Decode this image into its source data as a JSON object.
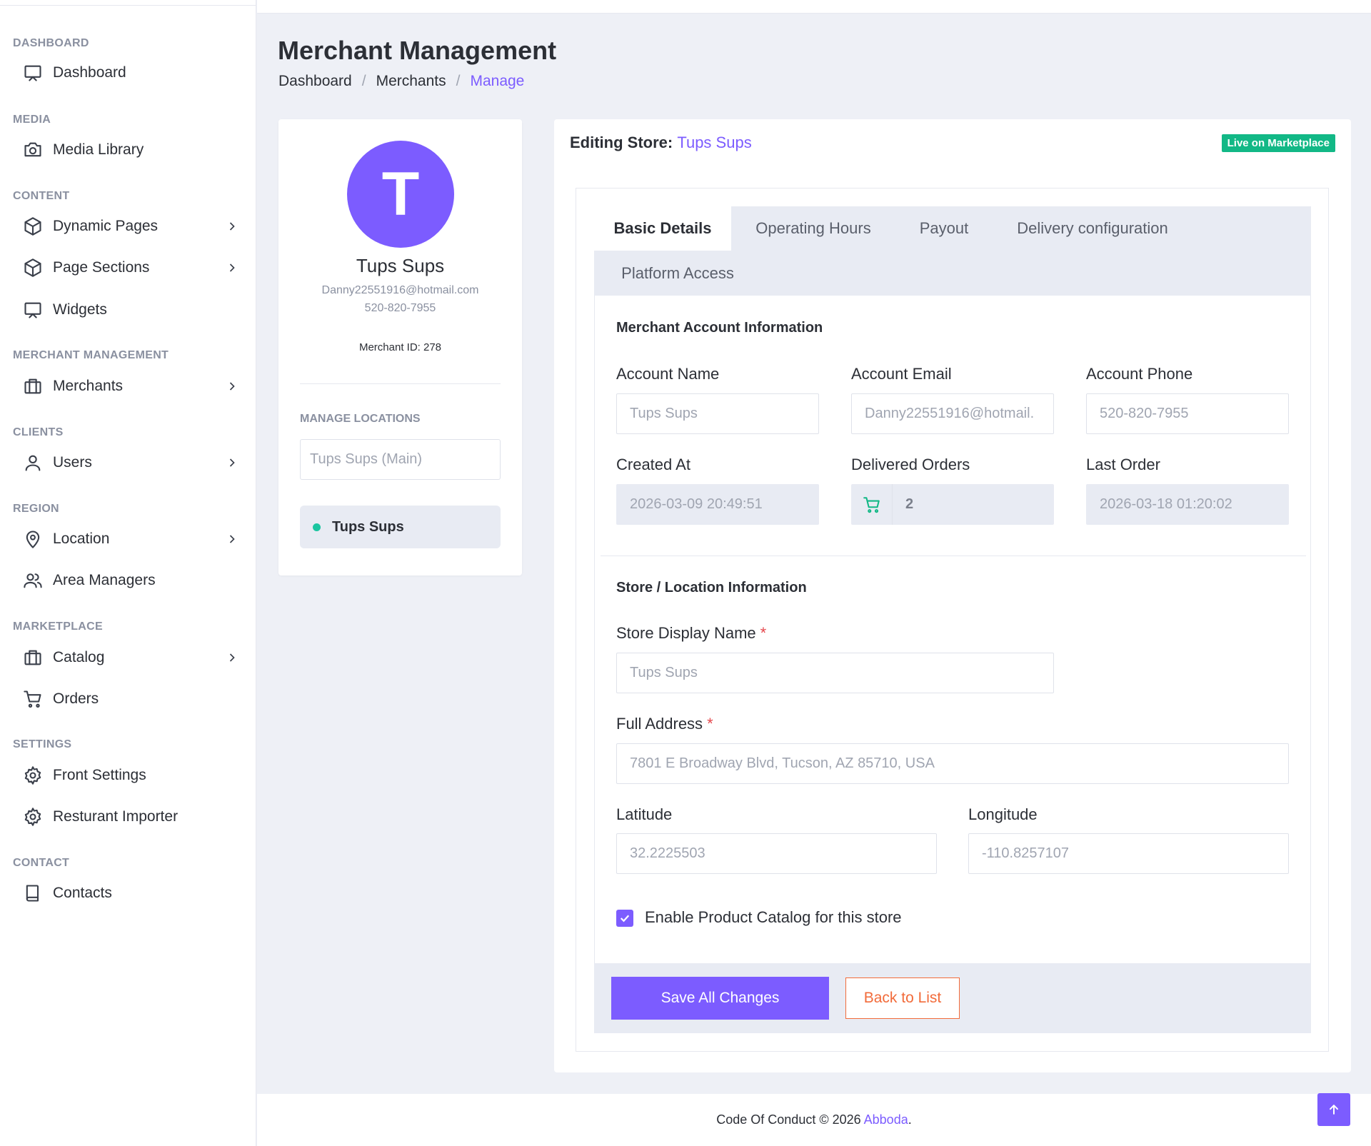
{
  "sidebar": {
    "sections": [
      {
        "title": "DASHBOARD",
        "items": [
          {
            "label": "Dashboard",
            "icon": "monitor-icon"
          }
        ]
      },
      {
        "title": "MEDIA",
        "items": [
          {
            "label": "Media Library",
            "icon": "camera-icon"
          }
        ]
      },
      {
        "title": "CONTENT",
        "items": [
          {
            "label": "Dynamic Pages",
            "icon": "box-icon",
            "submenu": true
          },
          {
            "label": "Page Sections",
            "icon": "box-icon",
            "submenu": true
          },
          {
            "label": "Widgets",
            "icon": "monitor-icon"
          }
        ]
      },
      {
        "title": "MERCHANT MANAGEMENT",
        "items": [
          {
            "label": "Merchants",
            "icon": "briefcase-icon",
            "submenu": true
          }
        ]
      },
      {
        "title": "CLIENTS",
        "items": [
          {
            "label": "Users",
            "icon": "user-icon",
            "submenu": true
          }
        ]
      },
      {
        "title": "REGION",
        "items": [
          {
            "label": "Location",
            "icon": "map-pin-icon",
            "submenu": true
          },
          {
            "label": "Area Managers",
            "icon": "users-icon"
          }
        ]
      },
      {
        "title": "MARKETPLACE",
        "items": [
          {
            "label": "Catalog",
            "icon": "briefcase-icon",
            "submenu": true
          },
          {
            "label": "Orders",
            "icon": "cart-icon"
          }
        ]
      },
      {
        "title": "SETTINGS",
        "items": [
          {
            "label": "Front Settings",
            "icon": "gear-icon"
          },
          {
            "label": "Resturant Importer",
            "icon": "gear-icon"
          }
        ]
      },
      {
        "title": "CONTACT",
        "items": [
          {
            "label": "Contacts",
            "icon": "book-icon"
          }
        ]
      }
    ]
  },
  "header": {
    "title": "Merchant Management",
    "breadcrumb": [
      "Dashboard",
      "Merchants",
      "Manage"
    ]
  },
  "profile": {
    "initial": "T",
    "name": "Tups Sups",
    "email": "Danny22551916@hotmail.com",
    "phone": "520-820-7955",
    "merchant_id": "Merchant ID: 278",
    "manage_locations_label": "MANAGE LOCATIONS",
    "location_select_value": "Tups Sups (Main)",
    "active_location": "Tups Sups"
  },
  "editor": {
    "heading_prefix": "Editing Store:",
    "store_name": "Tups Sups",
    "status_badge": "Live on Marketplace",
    "tabs": [
      "Basic Details",
      "Operating Hours",
      "Payout",
      "Delivery configuration",
      "Platform Access"
    ],
    "active_tab": "Basic Details",
    "account_section": {
      "title": "Merchant Account Information",
      "account_name_label": "Account Name",
      "account_name_value": "Tups Sups",
      "account_email_label": "Account Email",
      "account_email_value": "Danny22551916@hotmail.",
      "account_phone_label": "Account Phone",
      "account_phone_value": "520-820-7955",
      "created_at_label": "Created At",
      "created_at_value": "2026-03-09 20:49:51",
      "delivered_orders_label": "Delivered Orders",
      "delivered_orders_value": "2",
      "last_order_label": "Last Order",
      "last_order_value": "2026-03-18 01:20:02"
    },
    "store_section": {
      "title": "Store / Location Information",
      "display_name_label": "Store Display Name",
      "display_name_value": "Tups Sups",
      "address_label": "Full Address",
      "address_value": "7801 E Broadway Blvd, Tucson, AZ 85710, USA",
      "latitude_label": "Latitude",
      "latitude_value": "32.2225503",
      "longitude_label": "Longitude",
      "longitude_value": "-110.8257107",
      "required_mark": "*",
      "catalog_checkbox_label": "Enable Product Catalog for this store",
      "catalog_checked": true
    },
    "save_label": "Save All Changes",
    "back_label": "Back to List"
  },
  "footer": {
    "copyright_prefix": "Code Of Conduct © 2026",
    "brand": "Abboda",
    "suffix": "."
  },
  "colors": {
    "accent": "#7c5cff",
    "success": "#12b886",
    "warning": "#f26b3a",
    "danger": "#e5484d"
  }
}
